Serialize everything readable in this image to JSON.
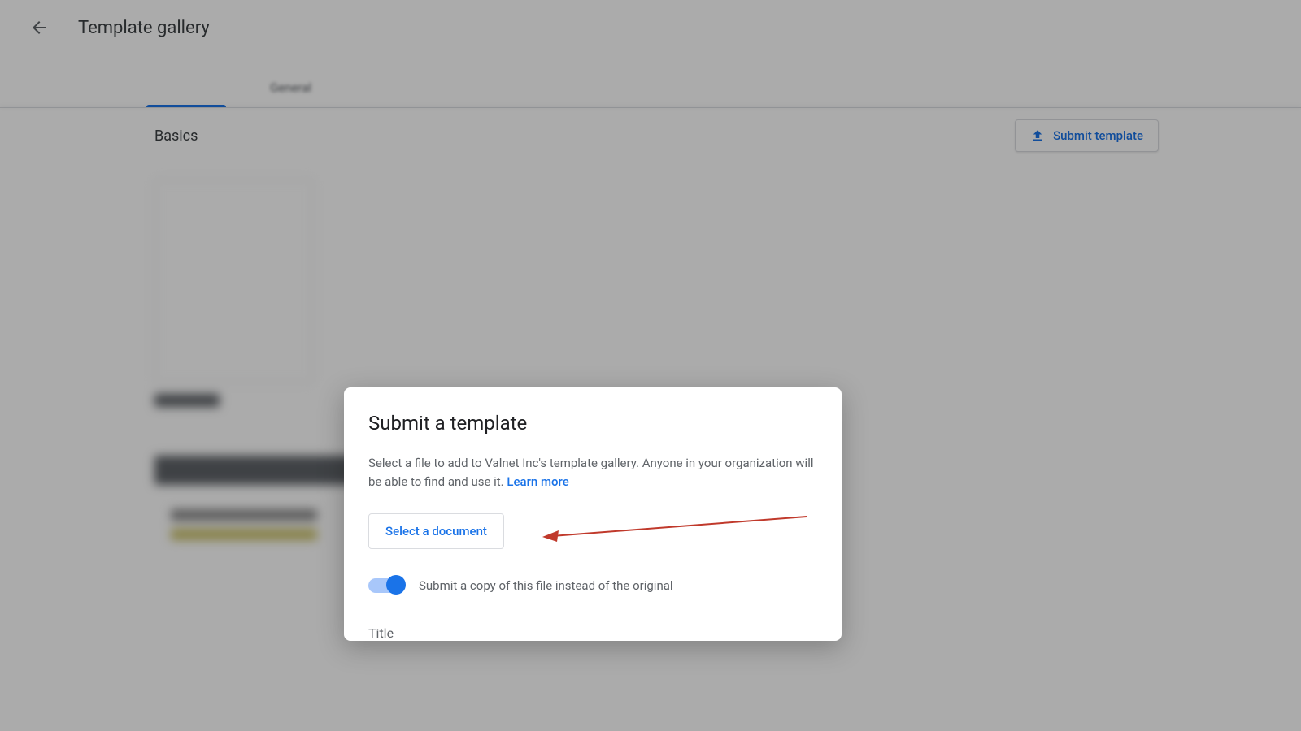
{
  "header": {
    "title": "Template gallery"
  },
  "tabs": {
    "active_label": "",
    "general": "General"
  },
  "section": {
    "title": "Basics",
    "submit_button": "Submit template"
  },
  "dialog": {
    "title": "Submit a template",
    "description": "Select a file to add to Valnet Inc's template gallery. Anyone in your organization will be able to find and use it. ",
    "learn_more": "Learn more",
    "select_button": "Select a document",
    "toggle_label": "Submit a copy of this file instead of the original",
    "title_field_label": "Title"
  },
  "colors": {
    "primary": "#1a73e8",
    "text": "#3c4043",
    "secondary_text": "#5f6368"
  }
}
